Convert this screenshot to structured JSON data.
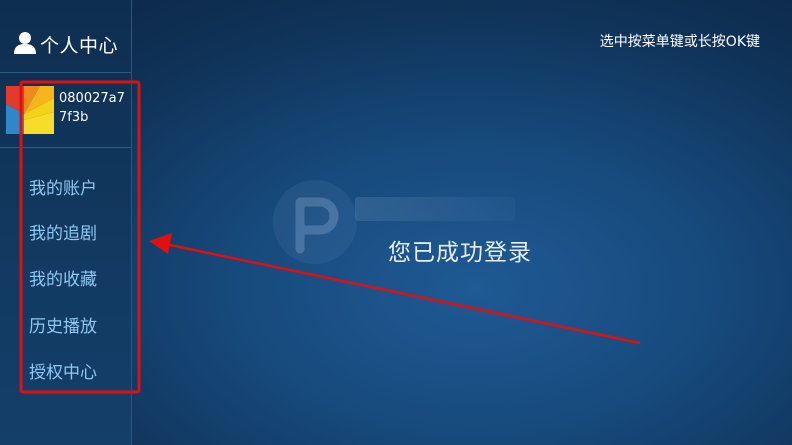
{
  "sidebar": {
    "title": "个人中心",
    "icon": "user-icon",
    "account_id": "080027a77f3b",
    "items": [
      {
        "label": "我的账户"
      },
      {
        "label": "我的追剧"
      },
      {
        "label": "我的收藏"
      },
      {
        "label": "历史播放"
      },
      {
        "label": "授权中心"
      }
    ]
  },
  "header": {
    "hint": "选中按菜单键或长按OK键"
  },
  "main": {
    "status_message": "您已成功登录"
  },
  "colors": {
    "menu_text": "#8fc8f2",
    "annotation_red": "#e01010",
    "background": "#174a7d"
  }
}
